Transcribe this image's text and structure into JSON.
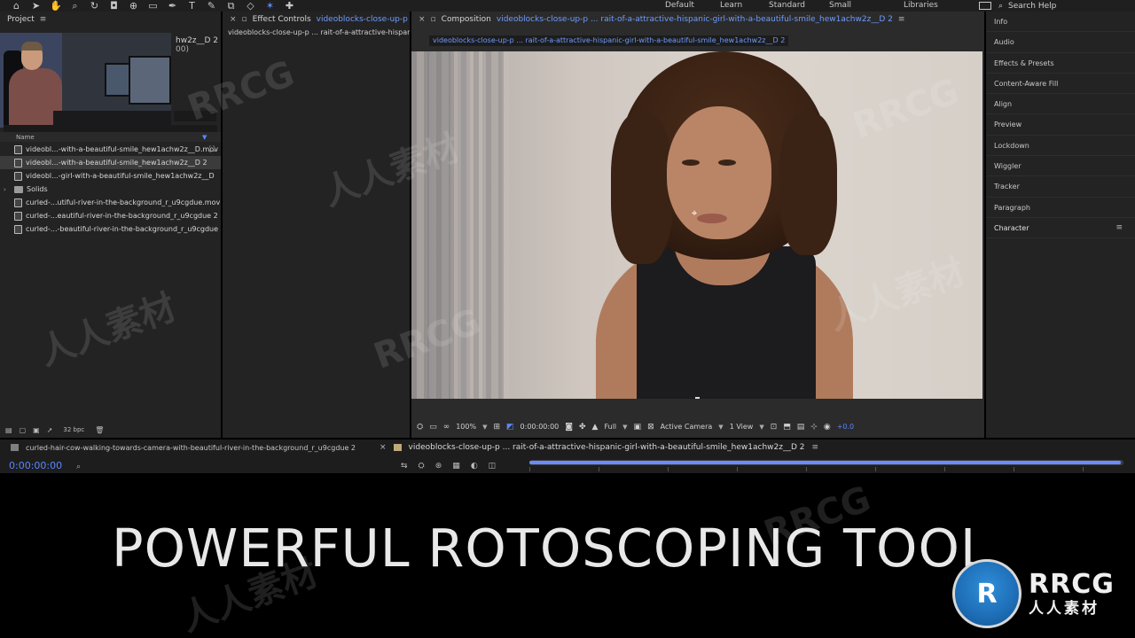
{
  "toolbar": {
    "tools": [
      "home-icon",
      "arrow-icon",
      "hand-icon",
      "zoom-icon",
      "rotate-icon",
      "camera-icon",
      "anchor-icon",
      "rect-icon",
      "pen-icon",
      "type-icon",
      "brush-icon",
      "stamp-icon",
      "eraser-icon",
      "roto-brush-icon",
      "puppet-icon"
    ],
    "glyphs": [
      "⌂",
      "➤",
      "✋",
      "⌕",
      "↻",
      "◘",
      "⊕",
      "▭",
      "✒",
      "T",
      "✎",
      "⧉",
      "◇",
      "✶",
      "📌"
    ],
    "workspaces": [
      "Default",
      "Learn",
      "Standard",
      "Small Screen",
      "Libraries"
    ],
    "search_label": "Search Help"
  },
  "watermark": {
    "logo": "RRCG"
  },
  "project": {
    "title": "Project",
    "info_line1": "hw2z__D 2",
    "info_line2": "00)",
    "name_header": "Name",
    "items": [
      {
        "label": "videobl...-with-a-beautiful-smile_hew1achw2z__D.mov",
        "type": "footage"
      },
      {
        "label": "videobl...-with-a-beautiful-smile_hew1achw2z__D 2",
        "type": "comp",
        "selected": true
      },
      {
        "label": "videobl...-girl-with-a-beautiful-smile_hew1achw2z__D",
        "type": "footage"
      },
      {
        "label": "Solids",
        "type": "folder"
      },
      {
        "label": "curled-...utiful-river-in-the-background_r_u9cgdue.mov",
        "type": "footage"
      },
      {
        "label": "curled-...eautiful-river-in-the-background_r_u9cgdue 2",
        "type": "comp"
      },
      {
        "label": "curled-...-beautiful-river-in-the-background_r_u9cgdue",
        "type": "footage"
      }
    ],
    "bpc": "32 bpc"
  },
  "effect_controls": {
    "tab_label": "Effect Controls",
    "tab_source": "videoblocks-close-up-p",
    "subtitle": "videoblocks-close-up-p ... rait-of-a-attractive-hispanic"
  },
  "composition": {
    "tab_label": "Composition",
    "tab_source": "videoblocks-close-up-p ... rait-of-a-attractive-hispanic-girl-with-a-beautiful-smile_hew1achw2z__D 2",
    "sub_tab": "videoblocks-close-up-p ... rait-of-a-attractive-hispanic-girl-with-a-beautiful-smile_hew1achw2z__D 2",
    "zoom": "100%",
    "timecode": "0:00:00:00",
    "resolution": "Full",
    "camera": "Active Camera",
    "views": "1 View",
    "exposure": "+0.0"
  },
  "right_panel": {
    "items": [
      "Info",
      "Audio",
      "Effects & Presets",
      "Content-Aware Fill",
      "Align",
      "Preview",
      "Lockdown",
      "Wiggler",
      "Tracker",
      "Paragraph",
      "Character"
    ]
  },
  "timeline": {
    "tab1": "curled-hair-cow-walking-towards-camera-with-beautiful-river-in-the-background_r_u9cgdue 2",
    "tab2": "videoblocks-close-up-p ... rait-of-a-attractive-hispanic-girl-with-a-beautiful-smile_hew1achw2z__D 2",
    "current_time": "0:00:00:00",
    "work_area_fraction": 0.995
  },
  "caption": {
    "text": "POWERFUL ROTOSCOPING TOOL"
  },
  "brand": {
    "badge": "R",
    "name": "RRCG",
    "cn": "人人素材"
  },
  "colors": {
    "accent": "#5b86ff",
    "panel_bg": "#232323",
    "caption_bg": "#000000",
    "brand_blue": "#1d6db6"
  }
}
